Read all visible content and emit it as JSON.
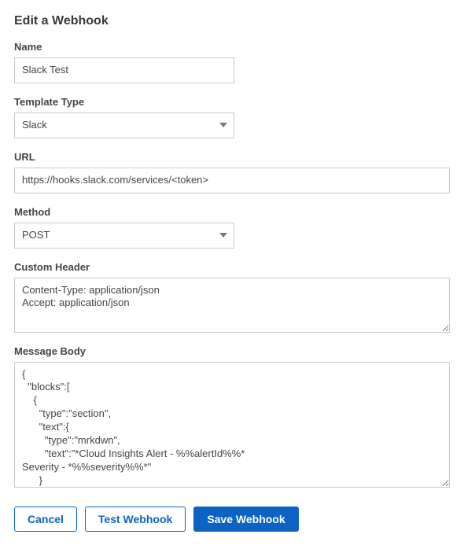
{
  "page_title": "Edit a Webhook",
  "fields": {
    "name": {
      "label": "Name",
      "value": "Slack Test"
    },
    "template_type": {
      "label": "Template Type",
      "value": "Slack"
    },
    "url": {
      "label": "URL",
      "value": "https://hooks.slack.com/services/<token>"
    },
    "method": {
      "label": "Method",
      "value": "POST"
    },
    "custom_header": {
      "label": "Custom Header",
      "value": "Content-Type: application/json\nAccept: application/json"
    },
    "message_body": {
      "label": "Message Body",
      "value": "{\n  \"blocks\":[\n    {\n      \"type\":\"section\",\n      \"text\":{\n        \"type\":\"mrkdwn\",\n        \"text\":\"*Cloud Insights Alert - %%alertId%%*\nSeverity - *%%severity%%*\"\n      }\n    },\n    {"
    }
  },
  "buttons": {
    "cancel": "Cancel",
    "test_webhook": "Test Webhook",
    "save_webhook": "Save Webhook"
  }
}
